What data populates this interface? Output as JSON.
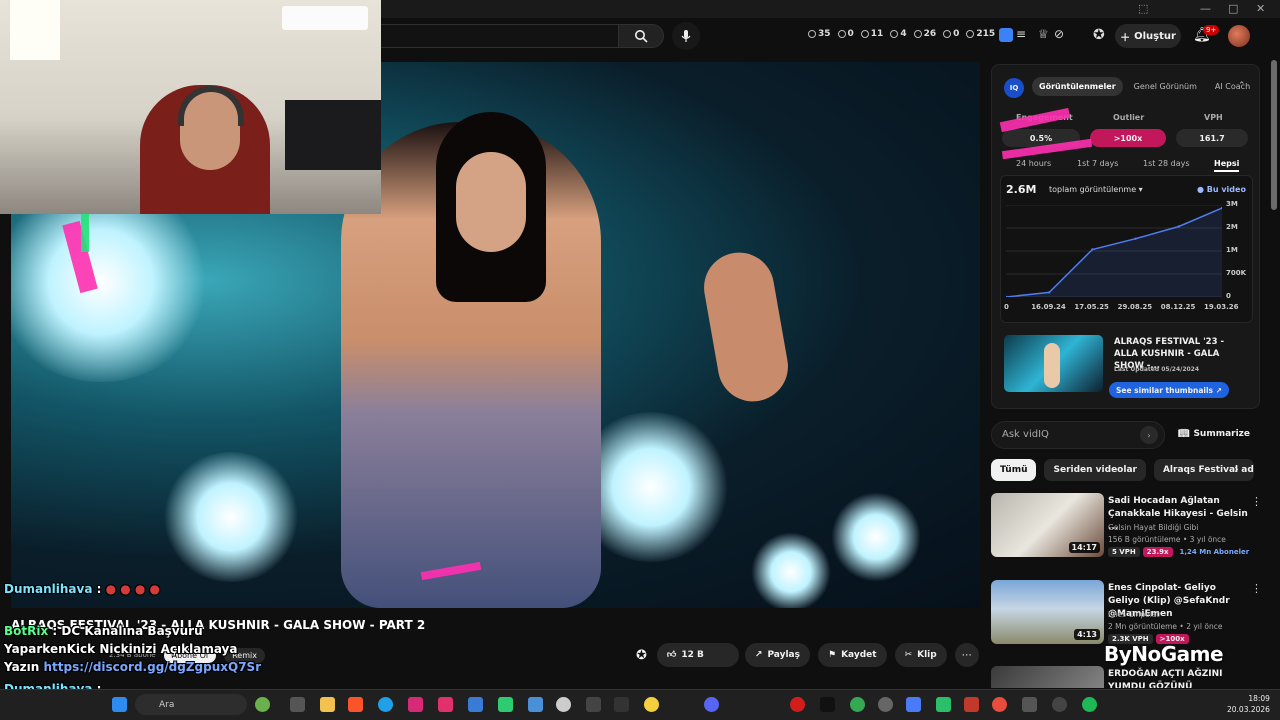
{
  "header": {
    "stats": [
      {
        "icon": "clock-icon",
        "value": "35"
      },
      {
        "icon": "eye-off-icon",
        "value": "0"
      },
      {
        "icon": "eye-icon",
        "value": "11"
      },
      {
        "icon": "tag-icon",
        "value": "4"
      },
      {
        "icon": "globe-icon",
        "value": "26"
      },
      {
        "icon": "alert-icon",
        "value": "0"
      },
      {
        "icon": "user-icon",
        "value": "215"
      }
    ],
    "create_label": "Oluştur",
    "notification_count": "9+"
  },
  "video": {
    "title": "ALRAQS FESTIVAL '23 - ALLA KUSHNIR - GALA SHOW - PART 2",
    "channel_subs": "2.34 B abone",
    "subscribe_label": "Abone Ol",
    "remix_label": "Remix",
    "like_count": "12 B",
    "share_label": "Paylaş",
    "save_label": "Kaydet",
    "clip_label": "Klip"
  },
  "chat": [
    {
      "user": "Dumanlihava",
      "text": ""
    },
    {
      "user": "BotRix",
      "text": ": DC Kanalına Başvuru"
    },
    {
      "user": "",
      "text": "YaparkenKick Nickinizi Açıklamaya"
    },
    {
      "user": "",
      "text": "Yazın",
      "link": "https://discord.gg/dgZgpuxQ7Sr"
    },
    {
      "user": "Dumanlihava",
      "text": ""
    }
  ],
  "vidiq": {
    "logo": "IQ",
    "tabs": [
      "Görüntülenmeler",
      "Genel Görünüm",
      "AI Coach"
    ],
    "metrics": [
      {
        "label": "Engagement",
        "value": "0.5%"
      },
      {
        "label": "Outlier",
        "value": ">100x"
      },
      {
        "label": "VPH",
        "value": "161.7"
      }
    ],
    "ranges": [
      "24 hours",
      "1st 7 days",
      "1st 28 days",
      "Hepsi"
    ],
    "total": "2.6M",
    "total_label": "toplam görüntülenme",
    "legend": "Bu video",
    "similar": {
      "title": "ALRAQS FESTIVAL '23 - ALLA KUSHNIR - GALA SHOW -...",
      "updated": "Last Updated 05/24/2024",
      "button": "See similar thumbnails"
    },
    "ask_placeholder": "Ask vidIQ",
    "summarize_label": "Summarize"
  },
  "chart_data": {
    "type": "line",
    "x": [
      "0",
      "16.09.24",
      "17.05.25",
      "29.08.25",
      "08.12.25",
      "19.03.26"
    ],
    "series": [
      {
        "name": "Bu video",
        "values": [
          0,
          0.15,
          1.55,
          1.9,
          2.3,
          2.9
        ]
      }
    ],
    "yticks": [
      "3M",
      "2M",
      "1M",
      "700K",
      "0"
    ],
    "ylim": [
      0,
      3
    ],
    "grid": true
  },
  "chips": [
    "Tümü",
    "Seriden videolar",
    "Alraqs Festival adlı y"
  ],
  "recommendations": [
    {
      "title": "Sadi Hocadan Ağlatan Çanakkale Hikayesi - Gelsin ...",
      "channel": "Gelsin Hayat Bildiği Gibi",
      "meta": "156 B görüntüleme • 3 yıl önce",
      "duration": "14:17",
      "badges": [
        "5 VPH",
        "23.9x",
        "1,24 Mn Aboneler"
      ]
    },
    {
      "title": "Enes Cinpolat- Geliyo Geliyo (Klip) @SefaKndr @MamiEmen",
      "channel": "Enes Cinpolat",
      "meta": "2 Mn görüntüleme • 2 yıl önce",
      "duration": "4:13",
      "badges": [
        "2.3K VPH",
        ">100x",
        ""
      ]
    },
    {
      "title": "ERDOĞAN AÇTI AĞZINI YUMDU GÖZÜNÜ \"Haydutlar, Siyonist",
      "channel": "",
      "meta": "",
      "duration": "",
      "badges": []
    }
  ],
  "watermark": "ByNoGame",
  "taskbar": {
    "search_label": "Ara",
    "time": "18:09",
    "date": "20.03.2026"
  }
}
